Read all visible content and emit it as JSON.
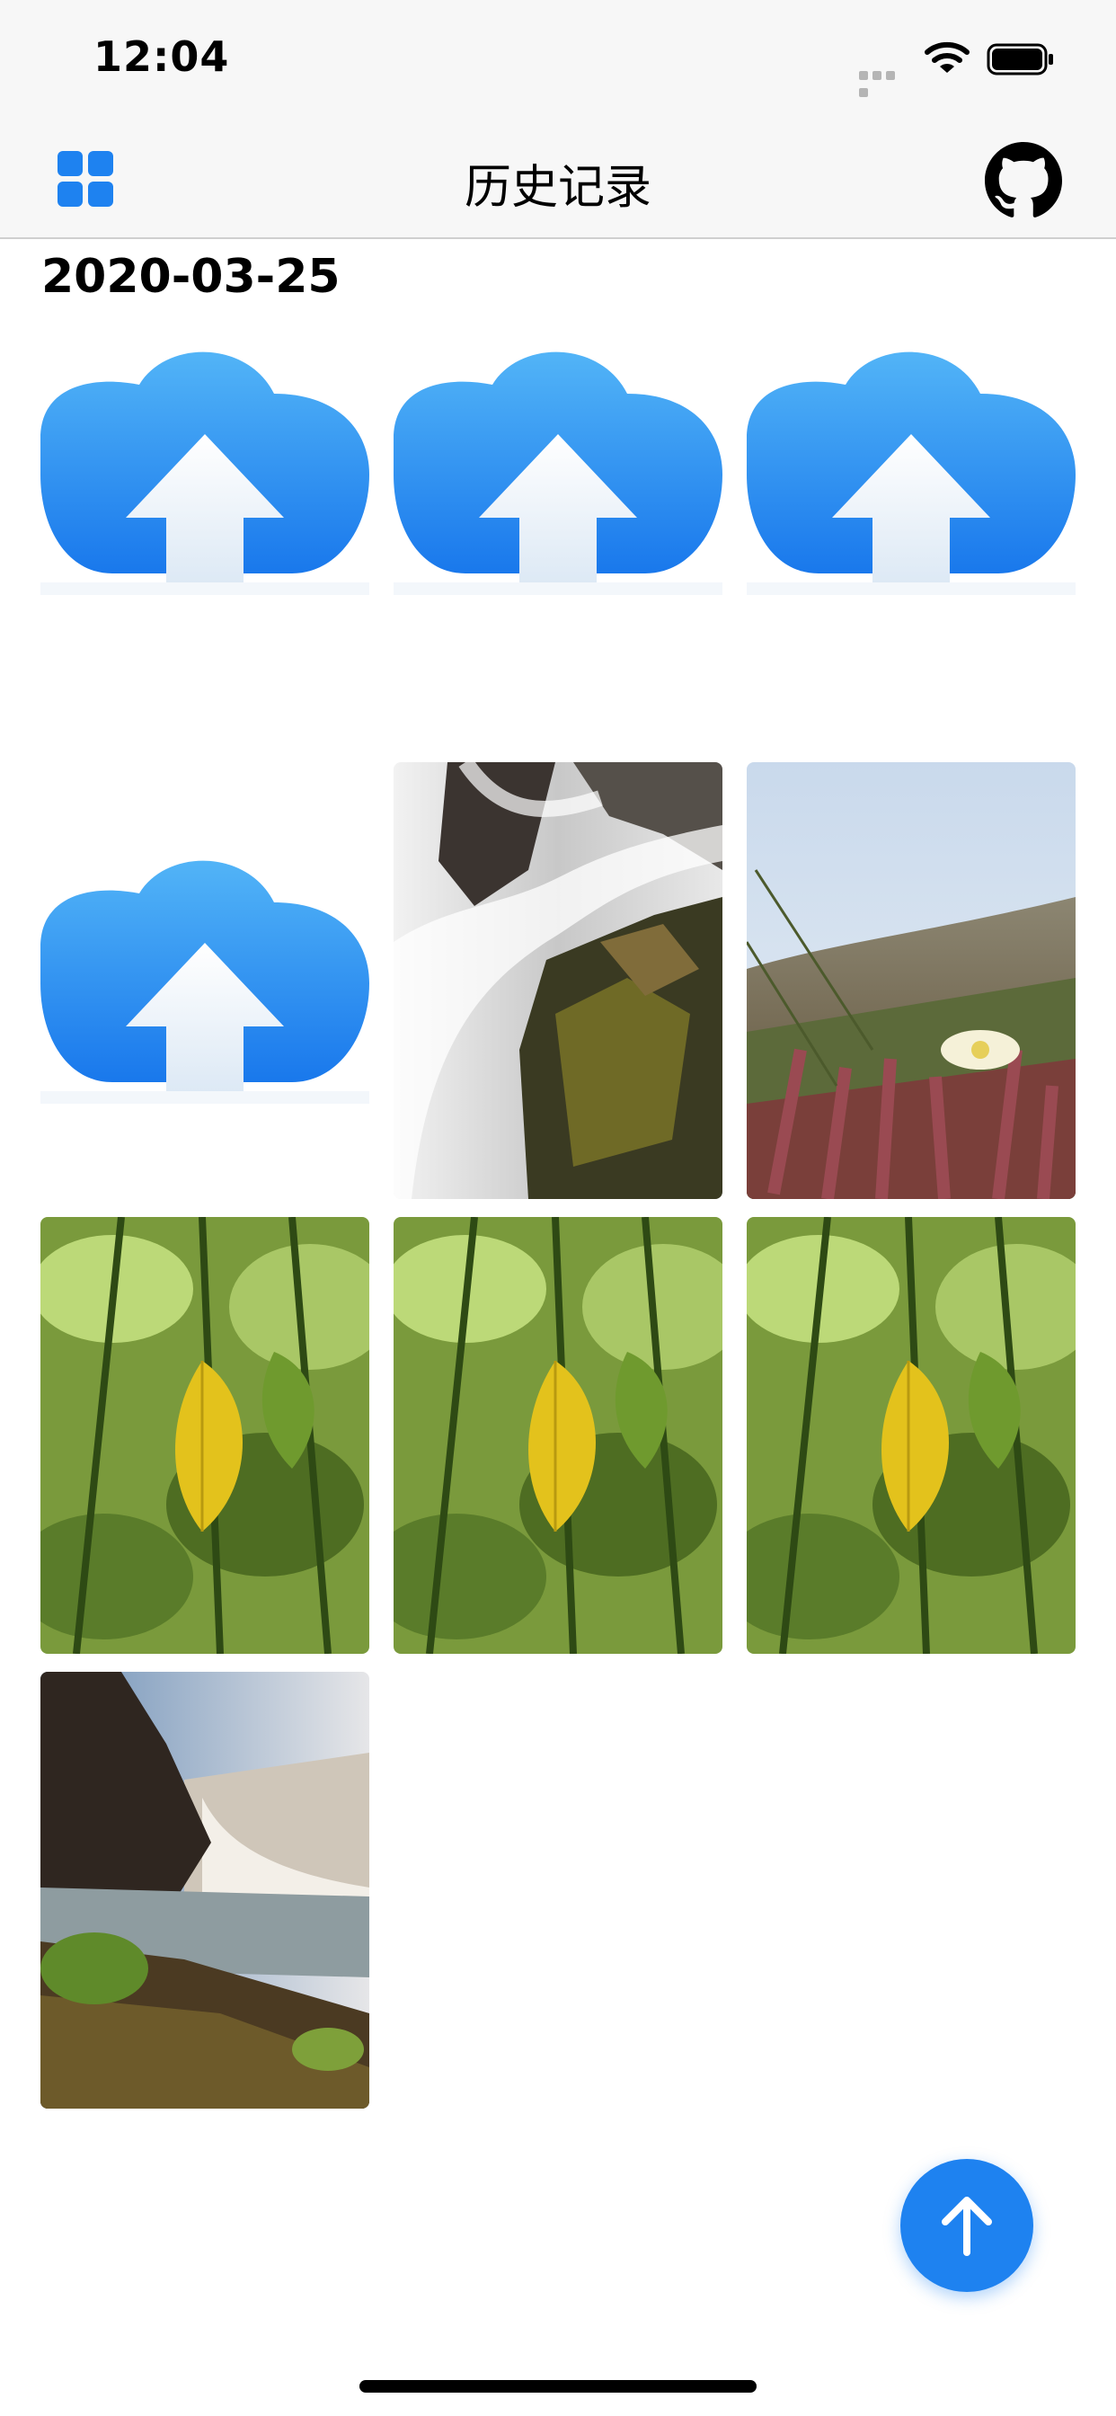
{
  "status_bar": {
    "time": "12:04",
    "battery_icon": "battery-full-icon",
    "wifi_icon": "wifi-icon",
    "signal_icon": "cellular-signal-icon"
  },
  "nav_bar": {
    "title": "历史记录",
    "left_icon": "grid-icon",
    "right_icon": "github-icon"
  },
  "section": {
    "date": "2020-03-25",
    "items": [
      {
        "kind": "upload-placeholder"
      },
      {
        "kind": "upload-placeholder"
      },
      {
        "kind": "upload-placeholder"
      },
      {
        "kind": "upload-placeholder"
      },
      {
        "kind": "photo",
        "subject": "waterfall over mossy rocks"
      },
      {
        "kind": "photo",
        "subject": "white flower among succulents"
      },
      {
        "kind": "photo",
        "subject": "yellow leaf on green plant"
      },
      {
        "kind": "photo",
        "subject": "yellow leaf on green plant"
      },
      {
        "kind": "photo",
        "subject": "yellow leaf on green plant"
      },
      {
        "kind": "photo",
        "subject": "waterfall with cliffs and lake"
      }
    ]
  },
  "fab": {
    "icon": "arrow-up-icon"
  },
  "colors": {
    "accent": "#1e82f0",
    "nav_background": "#f7f7f7"
  }
}
